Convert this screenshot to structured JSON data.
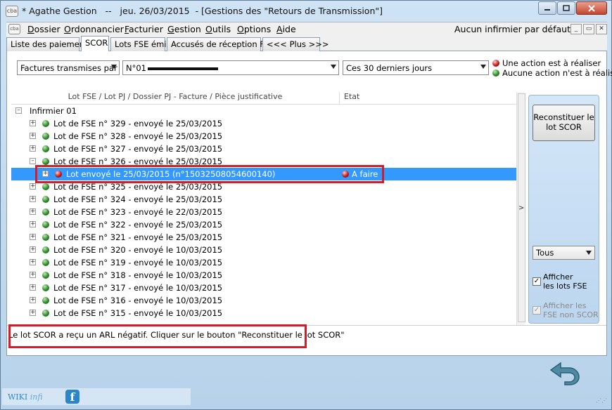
{
  "window": {
    "title": "* Agathe Gestion   --   jeu. 26/03/2015  - [Gestions des \"Retours de Transmission\"]",
    "app_icon": "cba",
    "controls": [
      "minimize-icon",
      "maximize-icon",
      "close-icon"
    ]
  },
  "menu": {
    "items": [
      {
        "label_u": "D",
        "label": "ossier"
      },
      {
        "label_u": "O",
        "label": "rdonnancier"
      },
      {
        "label_u": "F",
        "label": "acturier"
      },
      {
        "label_u": "G",
        "label": "estion"
      },
      {
        "label_u": "O",
        "label": "utils"
      },
      {
        "label_u": "O",
        "label": "ptions"
      },
      {
        "label_u": "A",
        "label": "ide"
      }
    ],
    "nurse_default": "Aucun infirmier par défaut",
    "mdi_min": "_",
    "mdi_restore": "▭",
    "mdi_close": "✕"
  },
  "tabs": [
    {
      "label": "Liste des paiements",
      "active": false
    },
    {
      "label": "SCOR",
      "active": true
    },
    {
      "label": "Lots FSE émis",
      "active": false
    },
    {
      "label": "Accusés de réception FSE",
      "active": false
    },
    {
      "label": "<<< Plus >>>",
      "active": false
    }
  ],
  "filters": {
    "mode": "Factures transmises par",
    "nurse_prefix": "N°01",
    "period": "Ces 30 derniers jours"
  },
  "legend": {
    "todo": "Une action est à réaliser",
    "none": "Aucune action n'est à réaliser",
    "colors": {
      "todo": "#c21a1a",
      "none": "#2f8a2a"
    }
  },
  "tree": {
    "columns": {
      "main": "Lot FSE / Lot PJ / Dossier PJ - Facture / Pièce justificative",
      "state": "Etat"
    },
    "root": "Infirmier 01",
    "rows": [
      {
        "label": "Lot de FSE n° 329 - envoyé le 25/03/2015"
      },
      {
        "label": "Lot de FSE n° 328 - envoyé le 25/03/2015"
      },
      {
        "label": "Lot de FSE n° 327 - envoyé le 25/03/2015"
      },
      {
        "label": "Lot de FSE n° 326 - envoyé le 25/03/2015"
      },
      {
        "label": "Lot envoyé le 25/03/2015 (n°15032508054600140)",
        "state": "A faire"
      },
      {
        "label": "Lot de FSE n° 325 - envoyé le 25/03/2015"
      },
      {
        "label": "Lot de FSE n° 324 - envoyé le 25/03/2015"
      },
      {
        "label": "Lot de FSE n° 323 - envoyé le 22/03/2015"
      },
      {
        "label": "Lot de FSE n° 322 - envoyé le 25/03/2015"
      },
      {
        "label": "Lot de FSE n° 321 - envoyé le 25/03/2015"
      },
      {
        "label": "Lot de FSE n° 320 - envoyé le 10/03/2015"
      },
      {
        "label": "Lot de FSE n° 319 - envoyé le 10/03/2015"
      },
      {
        "label": "Lot de FSE n° 318 - envoyé le 10/03/2015"
      },
      {
        "label": "Lot de FSE n° 317 - envoyé le 10/03/2015"
      },
      {
        "label": "Lot de FSE n° 316 - envoyé le 10/03/2015"
      },
      {
        "label": "Lot de FSE n° 315 - envoyé le 10/03/2015"
      }
    ],
    "splitter": ">"
  },
  "right_panel": {
    "rebuild_button": "Reconstituer le lot SCOR",
    "filter_value": "Tous",
    "show_lots_label_1": "Afficher",
    "show_lots_label_2": "les lots FSE",
    "show_non_scor_label_1": "Afficher les",
    "show_non_scor_label_2": "FSE non SCOR"
  },
  "message": "Le lot SCOR a reçu un ARL négatif. Cliquer sur le bouton \"Reconstituer le lot SCOR\"",
  "footer": {
    "wiki": "WIKI",
    "wiki_suffix": "infi",
    "facebook": "f"
  }
}
